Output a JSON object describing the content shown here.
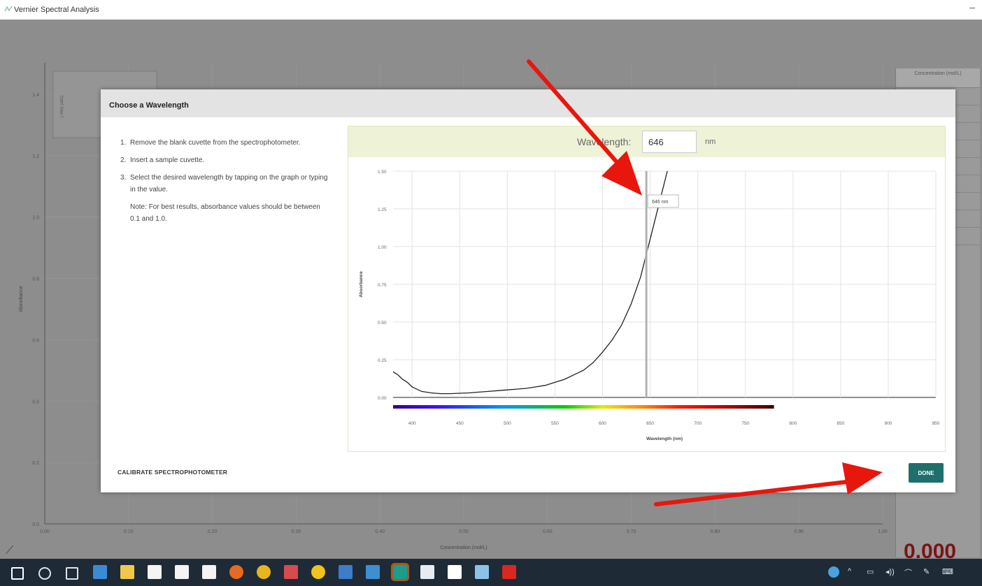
{
  "window": {
    "title": "Vernier Spectral Analysis",
    "minimize": "–"
  },
  "background": {
    "y_axis_label": "Absorbance",
    "x_axis_label": "Concentration (mol/L)",
    "y_ticks": [
      "1.4",
      "1.2",
      "1.0",
      "0.8",
      "0.6",
      "0.4",
      "0.2",
      "0.0"
    ],
    "x_ticks": [
      "0.00",
      "0.10",
      "0.20",
      "0.30",
      "0.40",
      "0.50",
      "0.60",
      "0.70",
      "0.80",
      "0.90",
      "1.00"
    ],
    "legend_text": "( Abs) (abs)",
    "panel_header": "Concentration (mol/L)",
    "big_value": "0.000"
  },
  "dialog": {
    "title": "Choose a Wavelength",
    "steps": [
      {
        "num": "1.",
        "text": "Remove the blank cuvette from the spectrophotometer."
      },
      {
        "num": "2.",
        "text": "Insert a sample cuvette."
      },
      {
        "num": "3.",
        "text": "Select the desired wavelength by tapping on the graph or typing in the value."
      }
    ],
    "note": "Note: For best results, absorbance values should be between 0.1 and 1.0.",
    "calibrate_label": "CALIBRATE SPECTROPHOTOMETER",
    "done_label": "DONE",
    "wavelength_label": "Wavelength:",
    "wavelength_value": "646",
    "wavelength_unit": "nm"
  },
  "chart_data": {
    "type": "line",
    "xlabel": "Wavelength (nm)",
    "ylabel": "Absorbance",
    "xlim": [
      380,
      950
    ],
    "ylim": [
      0,
      1.5
    ],
    "x_ticks": [
      400,
      450,
      500,
      550,
      600,
      650,
      700,
      750,
      800,
      850,
      900,
      950
    ],
    "y_ticks": [
      "0.00",
      "0.25",
      "0.50",
      "0.75",
      "1.00",
      "1.25",
      "1.50"
    ],
    "grid": true,
    "series": [
      {
        "x": [
          380,
          385,
          390,
          395,
          400,
          410,
          420,
          430,
          440,
          450,
          460,
          470,
          480,
          490,
          500,
          510,
          520,
          530,
          540,
          550,
          560,
          570,
          580,
          590,
          600,
          610,
          620,
          630,
          640,
          646,
          650,
          660,
          670
        ],
        "y": [
          0.17,
          0.15,
          0.12,
          0.1,
          0.07,
          0.04,
          0.03,
          0.025,
          0.025,
          0.028,
          0.03,
          0.035,
          0.04,
          0.045,
          0.05,
          0.055,
          0.06,
          0.07,
          0.08,
          0.1,
          0.12,
          0.15,
          0.18,
          0.23,
          0.3,
          0.38,
          0.48,
          0.62,
          0.8,
          0.95,
          1.05,
          1.3,
          1.55
        ]
      }
    ],
    "selected_wavelength": 646,
    "selected_label": "646 nm",
    "spectrum_bar_range": [
      380,
      780
    ]
  },
  "taskbar": {
    "icons": [
      "windows-start-icon",
      "search-icon",
      "task-view-icon",
      "edge-icon",
      "file-explorer-icon",
      "store-icon",
      "dropbox-icon",
      "mail-icon",
      "firefox-icon",
      "chrome-icon",
      "paint-icon",
      "norton-icon",
      "app-icon",
      "app-icon",
      "spectral-analysis-icon",
      "notepad-icon",
      "file-icon",
      "image-icon",
      "pdf-icon"
    ],
    "tray": [
      "^",
      "▭",
      "◂))",
      "⌒",
      "✎",
      "⌨"
    ]
  }
}
